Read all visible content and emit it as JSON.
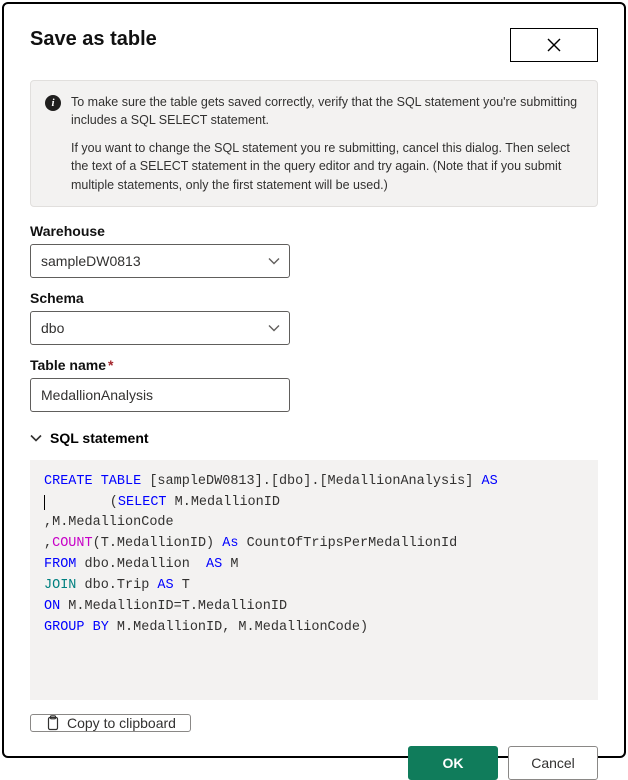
{
  "dialog": {
    "title": "Save as table",
    "info": {
      "para1": "To make sure the table gets saved correctly, verify that the SQL statement you're submitting includes a SQL SELECT statement.",
      "para2": "If you want to change the SQL statement you re submitting, cancel this dialog. Then select the text of a SELECT statement in the query editor and try again. (Note that if you submit multiple statements, only the first statement will be used.)"
    }
  },
  "form": {
    "warehouse": {
      "label": "Warehouse",
      "value": "sampleDW0813"
    },
    "schema": {
      "label": "Schema",
      "value": "dbo"
    },
    "tableName": {
      "label": "Table name",
      "value": "MedallionAnalysis",
      "required": "*"
    }
  },
  "sql": {
    "header": "SQL statement",
    "tokens": {
      "createTable": "CREATE TABLE",
      "targetOpen": " [sampleDW0813].[dbo].[MedallionAnalysis] ",
      "as": "AS",
      "indentSelect": "        (",
      "select": "SELECT",
      "selectCols": " M.MedallionID",
      "line3": ",M.MedallionCode",
      "comma4": ",",
      "count": "COUNT",
      "countArg": "(T.MedallionID) ",
      "asKw": "As ",
      "countAlias": "CountOfTripsPerMedallionId",
      "from": "FROM",
      "fromRest": " dbo.Medallion  ",
      "asBlue": "AS",
      "aliasM": " M",
      "join": "JOIN",
      "joinRest": " dbo.Trip ",
      "aliasT": " T",
      "on": "ON",
      "onRest": " M.MedallionID=T.MedallionID",
      "groupBy": "GROUP BY",
      "groupByRest": " M.MedallionID, M.MedallionCode)"
    }
  },
  "buttons": {
    "copy": "Copy to clipboard",
    "ok": "OK",
    "cancel": "Cancel"
  },
  "chart_data": null
}
